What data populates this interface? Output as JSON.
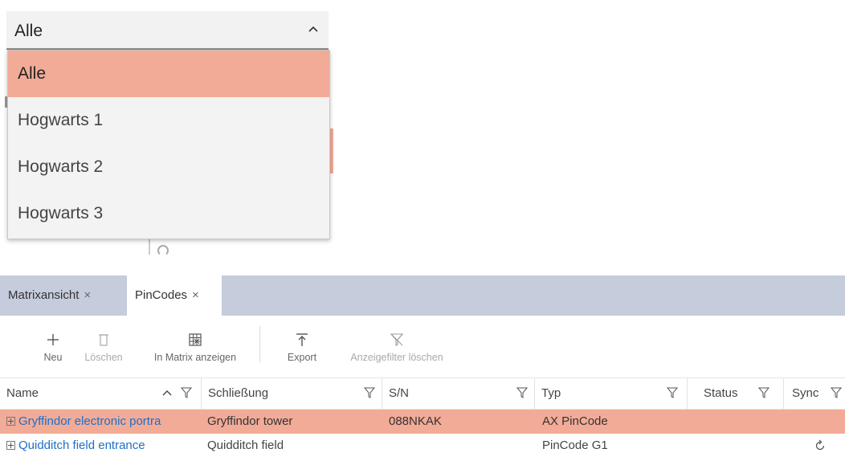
{
  "dropdown": {
    "selected": "Alle",
    "options": [
      "Alle",
      "Hogwarts 1",
      "Hogwarts 2",
      "Hogwarts 3"
    ]
  },
  "tabs": [
    {
      "label": "Matrixansicht",
      "close": "×"
    },
    {
      "label": "PinCodes",
      "close": "×"
    }
  ],
  "toolbar": {
    "new_label": "Neu",
    "delete_label": "Löschen",
    "matrix_label": "In Matrix anzeigen",
    "export_label": "Export",
    "clear_filter_label": "Anzeigefilter löschen"
  },
  "table": {
    "columns": [
      "Name",
      "Schließung",
      "S/N",
      "Typ",
      "Status",
      "Sync"
    ],
    "rows": [
      {
        "name": "Gryffindor electronic portra",
        "locking": "Gryffindor tower",
        "sn": "088NKAK",
        "type": "AX PinCode",
        "status": "",
        "sync": ""
      },
      {
        "name": "Quidditch field entrance",
        "locking": "Quidditch field",
        "sn": "",
        "type": "PinCode G1",
        "status": "",
        "sync": "refresh-icon"
      }
    ]
  },
  "colors": {
    "selection": "#f2ab97",
    "tabbar": "#c5ccdc",
    "link": "#1f6fc8"
  }
}
